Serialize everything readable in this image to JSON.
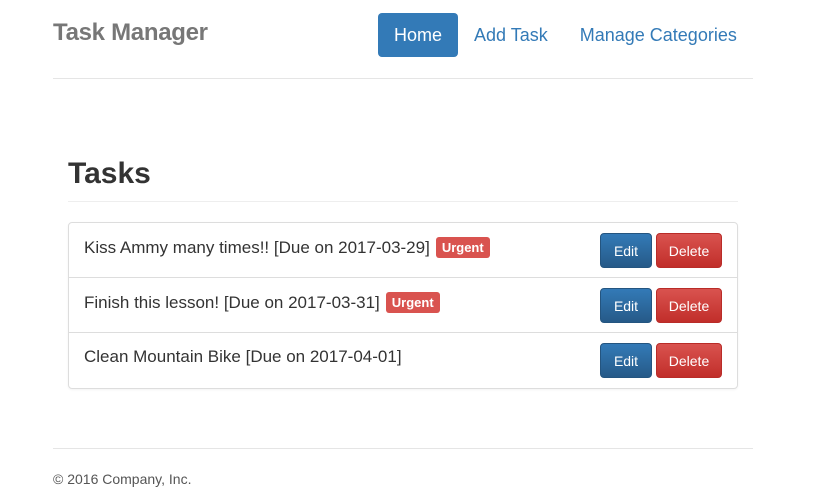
{
  "header": {
    "brand": "Task Manager",
    "nav": [
      {
        "label": "Home",
        "active": true
      },
      {
        "label": "Add Task"
      },
      {
        "label": "Manage Categories"
      }
    ]
  },
  "main": {
    "title": "Tasks",
    "tasks": [
      {
        "text": "Kiss Ammy many times!! [Due on 2017-03-29]",
        "badge": "Urgent",
        "edit": "Edit",
        "delete": "Delete"
      },
      {
        "text": "Finish this lesson! [Due on 2017-03-31]",
        "badge": "Urgent",
        "edit": "Edit",
        "delete": "Delete"
      },
      {
        "text": "Clean Mountain Bike [Due on 2017-04-01]",
        "badge": null,
        "edit": "Edit",
        "delete": "Delete"
      }
    ]
  },
  "footer": {
    "text": "© 2016 Company, Inc."
  },
  "colors": {
    "primary": "#337ab7",
    "danger": "#d9534f"
  }
}
